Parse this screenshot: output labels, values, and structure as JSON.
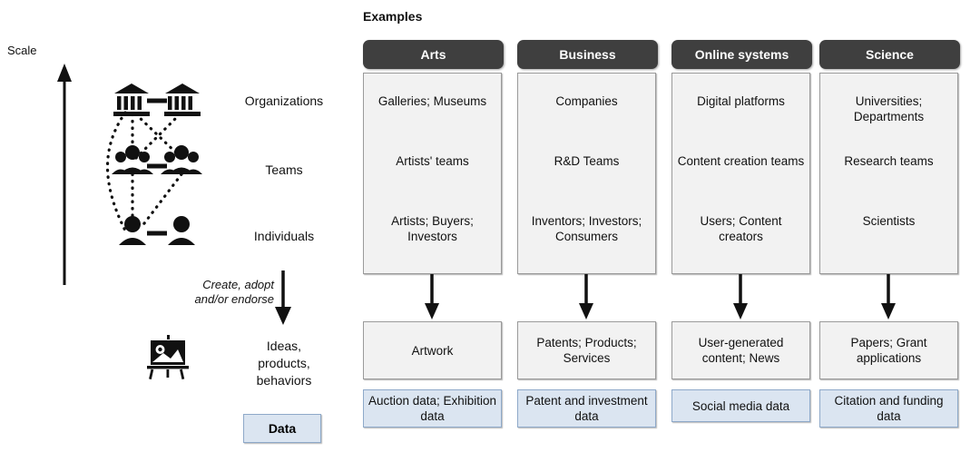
{
  "left_panel": {
    "scale_label": "Scale",
    "row_labels": [
      {
        "name": "organizations",
        "text": "Organizations"
      },
      {
        "name": "teams",
        "text": "Teams"
      },
      {
        "name": "individuals",
        "text": "Individuals"
      }
    ],
    "flow_label": "Create, adopt and/or endorse",
    "flow_label_line1": "Create, adopt",
    "flow_label_line2": "and/or endorse",
    "outcome_line1": "Ideas,",
    "outcome_line2": "products,",
    "outcome_line3": "behaviors",
    "data_legend": "Data",
    "icons": {
      "organization": "bank-institution-icon",
      "team": "group-of-people-icon",
      "individual": "single-person-icon",
      "artifact": "easel-picture-icon"
    }
  },
  "right_panel": {
    "section_title": "Examples",
    "columns": [
      {
        "header": "Arts",
        "levels": [
          "Galleries; Museums",
          "Artists' teams",
          "Artists; Buyers; Investors"
        ],
        "output": "Artwork",
        "data": "Auction data; Exhibition data"
      },
      {
        "header": "Business",
        "levels": [
          "Companies",
          "R&D Teams",
          "Inventors; Investors; Consumers"
        ],
        "output": "Patents; Products; Services",
        "data": "Patent and investment data"
      },
      {
        "header": "Online systems",
        "levels": [
          "Digital platforms",
          "Content creation teams",
          "Users; Content creators"
        ],
        "output": "User-generated content; News",
        "data": "Social media data"
      },
      {
        "header": "Science",
        "levels": [
          "Universities; Departments",
          "Research teams",
          "Scientists"
        ],
        "output": "Papers; Grant applications",
        "data": "Citation and funding data"
      }
    ]
  },
  "colors": {
    "header_bg": "#3f3f3f",
    "body_bg": "#f2f2f2",
    "data_bg": "#dbe5f1",
    "data_border": "#8ea9c9",
    "ink": "#111111"
  }
}
